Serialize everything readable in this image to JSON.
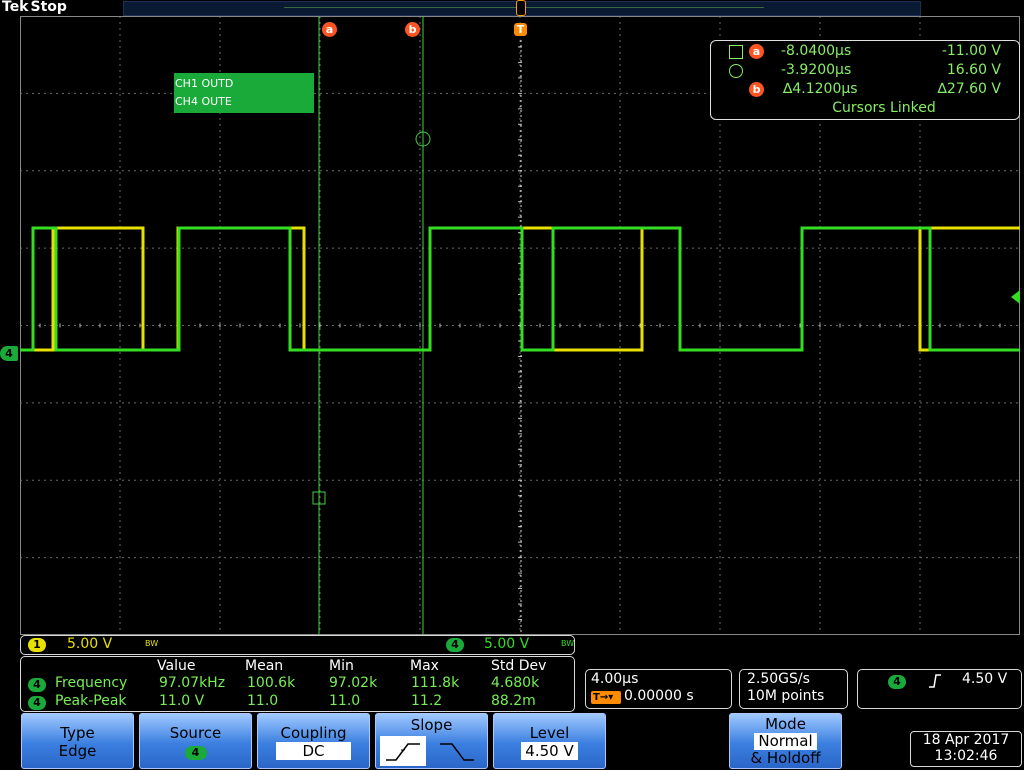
{
  "header": {
    "brand": "Tek",
    "status": "Stop"
  },
  "markers": {
    "cursor_a": "a",
    "cursor_b": "b",
    "trigger": "T",
    "ch4_ground": "4"
  },
  "channel_labels": [
    "CH1  OUTD",
    "CH4  OUTE"
  ],
  "cursor_readout": {
    "a": {
      "time": "-8.0400µs",
      "volt": "-11.00 V"
    },
    "b": {
      "time": "-3.9200µs",
      "volt": "16.60 V"
    },
    "delta": {
      "time": "∆4.1200µs",
      "volt": "∆27.60 V"
    },
    "linked": "Cursors Linked"
  },
  "scale_bar": {
    "ch1": {
      "num": "1",
      "scale": "5.00 V",
      "bw": "BW"
    },
    "ch4": {
      "num": "4",
      "scale": "5.00 V",
      "bw": "BW"
    }
  },
  "measurements": {
    "headers": [
      "Value",
      "Mean",
      "Min",
      "Max",
      "Std Dev"
    ],
    "rows": [
      {
        "ch": "4",
        "name": "Frequency",
        "value": "97.07kHz",
        "mean": "100.6k",
        "min": "97.02k",
        "max": "111.8k",
        "std": "4.680k"
      },
      {
        "ch": "4",
        "name": "Peak-Peak",
        "value": "11.0 V",
        "mean": "11.0",
        "min": "11.0",
        "max": "11.2",
        "std": "88.2m"
      }
    ]
  },
  "horizontal": {
    "scale": "4.00µs",
    "delay": "0.00000 s"
  },
  "acquisition": {
    "rate": "2.50GS/s",
    "points": "10M points"
  },
  "trigger_readout": {
    "ch": "4",
    "level": "4.50 V"
  },
  "menu": {
    "type": {
      "label": "Type",
      "value": "Edge"
    },
    "source": {
      "label": "Source",
      "value": "4"
    },
    "coupling": {
      "label": "Coupling",
      "value": "DC"
    },
    "slope": {
      "label": "Slope"
    },
    "level": {
      "label": "Level",
      "value": "4.50 V"
    },
    "mode": {
      "label": "Mode",
      "value1": "Normal",
      "value2": "& Holdoff"
    }
  },
  "datetime": {
    "date": "18 Apr  2017",
    "time": "13:02:46"
  },
  "colors": {
    "ch1": "#e8e000",
    "ch4": "#33dd22",
    "grid": "#6a6a6a",
    "cursor": "#44cc44"
  }
}
